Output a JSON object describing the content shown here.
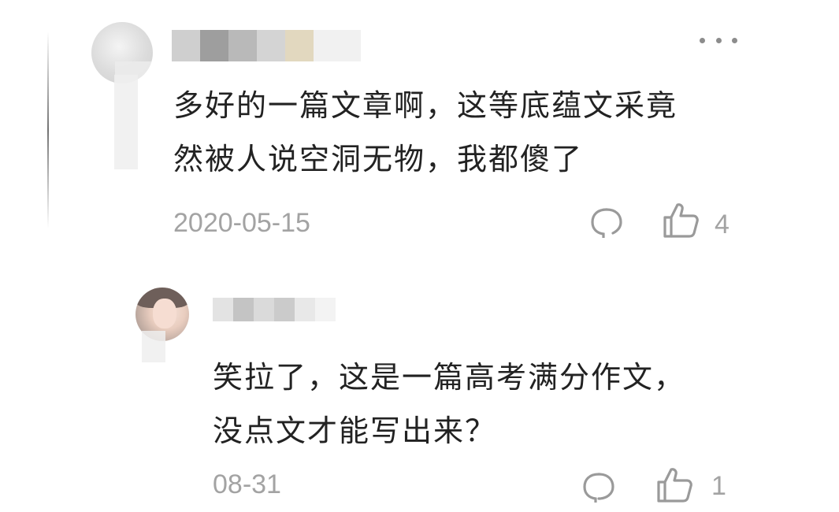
{
  "main_comment": {
    "text_line1": "多好的一篇文章啊，这等底蕴文采竟",
    "text_line2": "然被人说空洞无物，我都傻了",
    "date": "2020-05-15",
    "like_count": "4",
    "icons": {
      "more": "more-horizontal-icon",
      "reply": "comment-bubble-icon",
      "like": "thumbs-up-icon"
    }
  },
  "reply_comment": {
    "text_line1": "笑拉了，这是一篇高考满分作文，",
    "text_line2": "没点文才能写出来？",
    "date": "08-31",
    "like_count": "1",
    "icons": {
      "reply": "comment-bubble-icon",
      "like": "thumbs-up-icon"
    }
  },
  "colors": {
    "text": "#222222",
    "meta": "#a3a3a3",
    "icon": "#9a9a9a"
  }
}
